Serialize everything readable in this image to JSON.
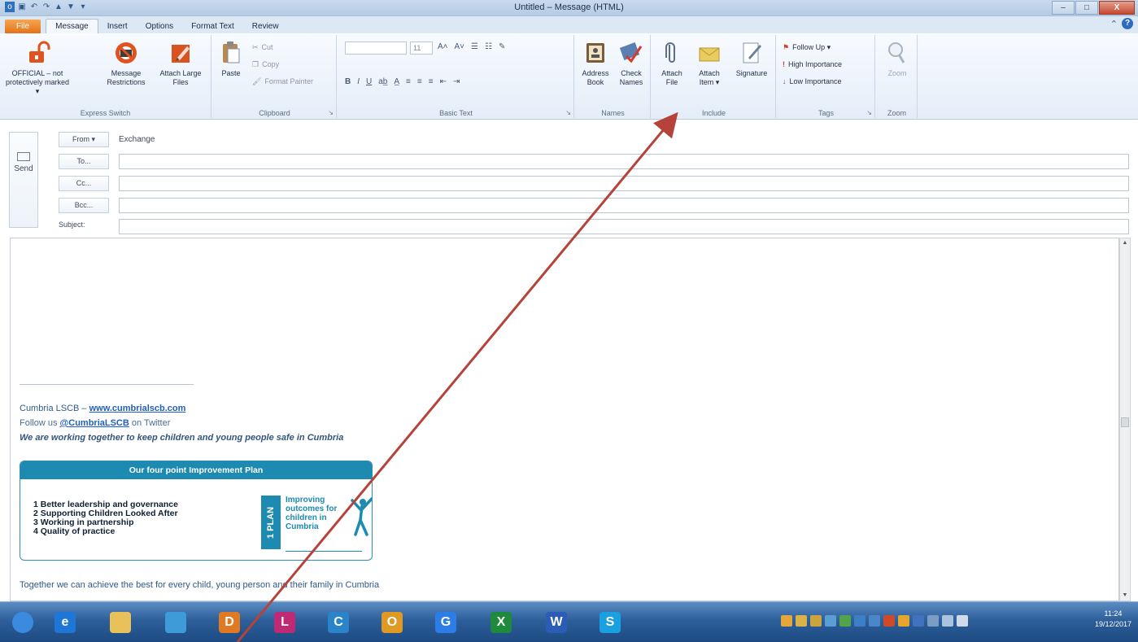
{
  "window": {
    "title": "Untitled – Message (HTML)",
    "controls": {
      "minimize": "–",
      "maximize": "□",
      "close": "X"
    }
  },
  "qat_icons": [
    "outlook-icon",
    "save-icon",
    "undo-icon",
    "redo-icon",
    "up-icon",
    "down-icon",
    "customize-icon"
  ],
  "tabs": [
    "File",
    "Message",
    "Insert",
    "Options",
    "Format Text",
    "Review"
  ],
  "active_tab": "Message",
  "ribbon": {
    "express_switch": {
      "label": "Express Switch",
      "buttons": [
        "OFFICIAL – not protectively marked ▾",
        "Message Restrictions",
        "Attach Large Files"
      ]
    },
    "clipboard": {
      "label": "Clipboard",
      "paste": "Paste",
      "cut": "Cut",
      "copy": "Copy",
      "format_painter": "Format Painter"
    },
    "basic_text": {
      "label": "Basic Text",
      "font_size": "11",
      "bold": "B",
      "italic": "I",
      "underline": "U"
    },
    "names": {
      "label": "Names",
      "address_book": "Address Book",
      "check_names": "Check Names"
    },
    "include": {
      "label": "Include",
      "attach_file": "Attach File",
      "attach_item": "Attach Item ▾",
      "signature": "Signature"
    },
    "tags": {
      "label": "Tags",
      "follow_up": "Follow Up ▾",
      "high_importance": "High Importance",
      "low_importance": "Low Importance"
    },
    "zoom": {
      "label": "Zoom",
      "zoom": "Zoom"
    }
  },
  "header": {
    "send": "Send",
    "from_button": "From ▾",
    "from_value": "Exchange",
    "to_button": "To...",
    "cc_button": "Cc...",
    "bcc_button": "Bcc...",
    "subject_label": "Subject:",
    "to_value": "",
    "cc_value": "",
    "bcc_value": "",
    "subject_value": ""
  },
  "signature": {
    "org": "Cumbria LSCB – ",
    "website": "www.cumbrialscb.com",
    "follow_prefix": "Follow us ",
    "twitter": "@CumbriaLSCB",
    "follow_suffix": " on Twitter",
    "tagline": "We are working together to keep children and young people safe in Cumbria",
    "plan_title": "Our four point Improvement Plan",
    "plan_items": [
      "1  Better leadership and governance",
      "2  Supporting Children Looked After",
      "3  Working in partnership",
      "4  Quality of practice"
    ],
    "plan_logo": "PLAN",
    "plan_logo_number": "1",
    "plan_text": [
      "Improving",
      "outcomes for",
      "children in",
      "Cumbria"
    ],
    "closing": "Together we can achieve the best for every child, young person and their family in Cumbria"
  },
  "taskbar": {
    "apps": [
      {
        "name": "start-orb",
        "color": "#3a8be0",
        "glyph": ""
      },
      {
        "name": "ie",
        "color": "#1e76d6",
        "glyph": "e"
      },
      {
        "name": "explorer",
        "color": "#e8c15a",
        "glyph": ""
      },
      {
        "name": "app-4",
        "color": "#3f9bd8",
        "glyph": ""
      },
      {
        "name": "app-5",
        "color": "#e07a22",
        "glyph": "D"
      },
      {
        "name": "app-6",
        "color": "#c02a75",
        "glyph": "L"
      },
      {
        "name": "app-7",
        "color": "#2a84c9",
        "glyph": "C"
      },
      {
        "name": "outlook",
        "color": "#e09a24",
        "glyph": "O"
      },
      {
        "name": "google-chrome",
        "color": "#2d7de8",
        "glyph": "G"
      },
      {
        "name": "excel",
        "color": "#1f8a3c",
        "glyph": "X"
      },
      {
        "name": "word",
        "color": "#2b5cb8",
        "glyph": "W"
      },
      {
        "name": "skype",
        "color": "#1aa0e0",
        "glyph": "S"
      }
    ],
    "time": "11:24",
    "date": "19/12/2017"
  }
}
